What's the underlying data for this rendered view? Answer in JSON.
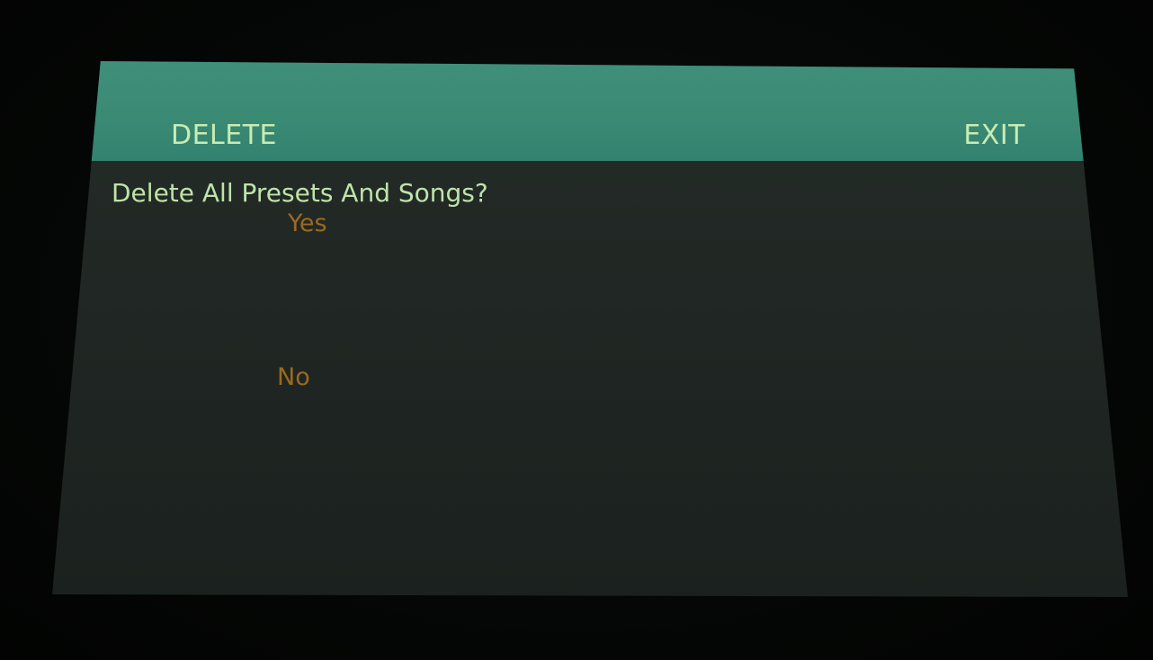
{
  "header": {
    "left_label": "DELETE",
    "right_label": "EXIT"
  },
  "dialog": {
    "prompt": "Delete All Presets And Songs?",
    "options": [
      {
        "label": "Yes"
      },
      {
        "label": "No"
      }
    ]
  },
  "colors": {
    "header_bg": "#3a8a74",
    "header_text": "#c8ecb2",
    "prompt_text": "#bfe3a8",
    "option_text": "#9a6a1e",
    "screen_bg": "#222a26"
  }
}
